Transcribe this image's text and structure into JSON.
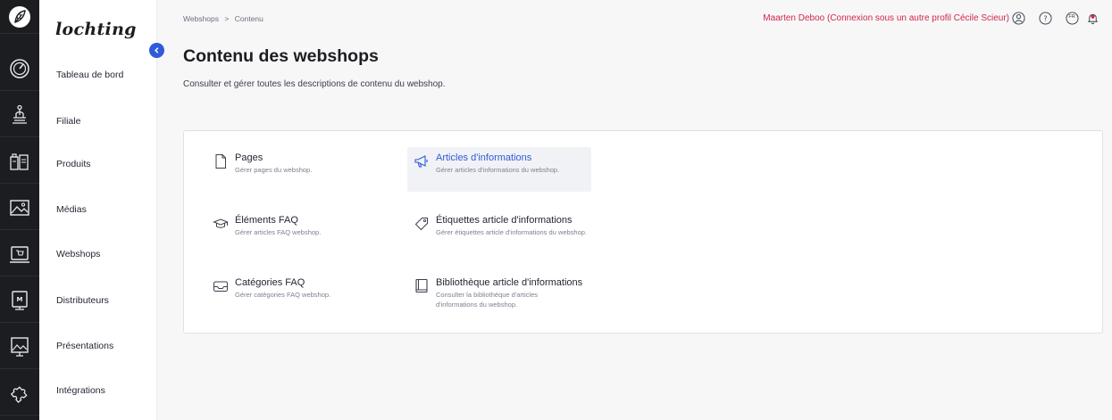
{
  "brand": {
    "logo_text": "lochting"
  },
  "rail": {
    "icons": [
      "leaf-logo-icon",
      "dashboard-gauge-icon",
      "store-pin-icon",
      "products-icon",
      "media-image-icon",
      "webshop-cart-icon",
      "distributor-screen-icon",
      "presentation-icon",
      "integrations-puzzle-icon"
    ]
  },
  "sidebar": {
    "items": [
      {
        "label": "Tableau de bord"
      },
      {
        "label": "Filiale"
      },
      {
        "label": "Produits"
      },
      {
        "label": "Médias"
      },
      {
        "label": "Webshops"
      },
      {
        "label": "Distributeurs"
      },
      {
        "label": "Présentations"
      },
      {
        "label": "Intégrations"
      }
    ]
  },
  "breadcrumb": {
    "parent": "Webshops",
    "separator": ">",
    "current": "Contenu"
  },
  "topbar": {
    "user_text": "Maarten Deboo (Connexion sous un autre profil Cécile Scieur)",
    "language": "FR",
    "icons": [
      "user-circle-icon",
      "help-icon",
      "language-icon",
      "notification-bell-icon"
    ]
  },
  "header": {
    "title": "Contenu des webshops",
    "subtitle": "Consulter et gérer toutes les descriptions de contenu du webshop."
  },
  "content": {
    "tiles": [
      {
        "title": "Pages",
        "description": "Gérer pages du webshop.",
        "icon": "page-icon"
      },
      {
        "title": "Articles d'informations",
        "description": "Gérer articles d'informations du webshop.",
        "icon": "megaphone-icon",
        "active": true
      },
      {
        "title": "Éléments FAQ",
        "description": "Gérer articles FAQ webshop.",
        "icon": "graduation-cap-icon"
      },
      {
        "title": "Étiquettes article d'informations",
        "description": "Gérer étiquettes article d'informations du webshop.",
        "icon": "tag-icon"
      },
      {
        "title": "Catégories FAQ",
        "description": "Gérer catégories FAQ webshop.",
        "icon": "inbox-tray-icon"
      },
      {
        "title": "Bibliothèque article d'informations",
        "description": "Consulter la bibliothèque d'articles d'informations du webshop.",
        "icon": "book-icon"
      }
    ]
  },
  "colors": {
    "accent": "#2f5bd9",
    "user_link": "#d0264a",
    "notification": "#d0264a",
    "rail_bg": "#1c1d21"
  }
}
